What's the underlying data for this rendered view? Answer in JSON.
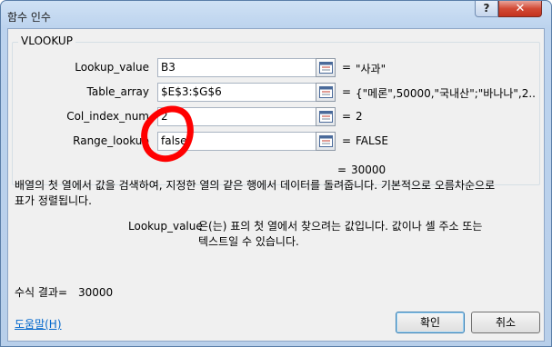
{
  "window": {
    "title": "함수 인수",
    "help_label": "?",
    "close_label": "✕"
  },
  "function": {
    "name": "VLOOKUP"
  },
  "arguments": [
    {
      "label": "Lookup_value",
      "value": "B3",
      "result": "\"사과\""
    },
    {
      "label": "Table_array",
      "value": "$E$3:$G$6",
      "result": "{\"메론\",50000,\"국내산\";\"바나나\",2..."
    },
    {
      "label": "Col_index_num",
      "value": "2",
      "result": "2"
    },
    {
      "label": "Range_lookup",
      "value": "false",
      "result": "FALSE"
    }
  ],
  "equals_sign": "=",
  "overall_result": "30000",
  "description": {
    "line1": "배열의 첫 열에서 값을 검색하여, 지정한 열의 같은 행에서 데이터를 돌려줍니다. 기본적으로 오름차순으로",
    "line2": "표가 정렬됩니다.",
    "arg_name": "Lookup_value",
    "arg_text1": "은(는) 표의 첫 열에서 찾으려는 값입니다. 값이나 셀 주소 또는",
    "arg_text2": "텍스트일 수 있습니다."
  },
  "formula_result": {
    "label": "수식 결과=",
    "value": "30000"
  },
  "help_link": "도움말(H)",
  "buttons": {
    "ok": "확인",
    "cancel": "취소"
  },
  "annotation_color": "#ff0000"
}
